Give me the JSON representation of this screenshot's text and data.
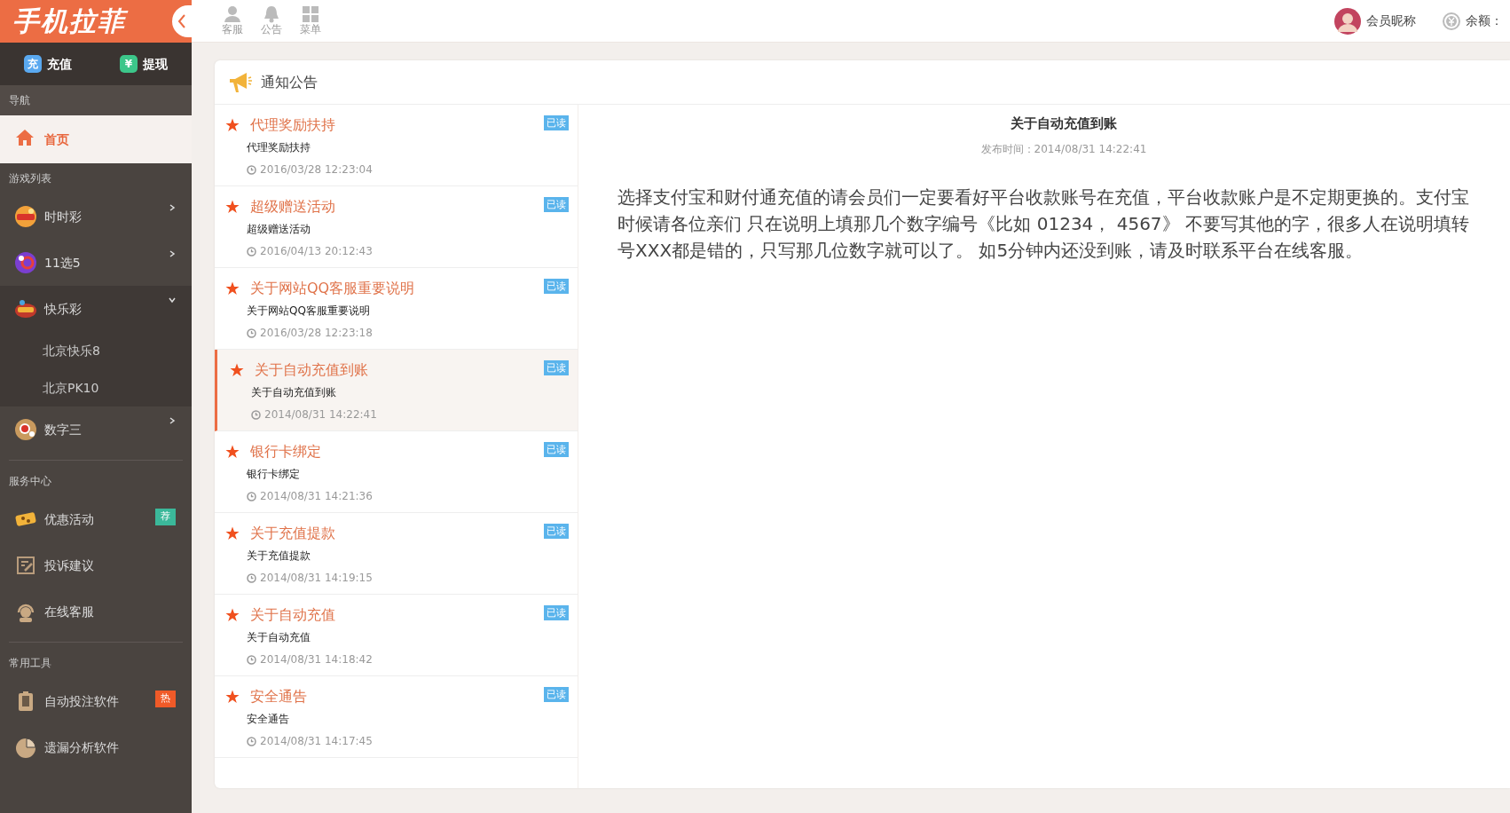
{
  "logo": {
    "text": "手机拉菲"
  },
  "quick_actions": [
    {
      "icon": "充",
      "label": "充值",
      "color": "#5aa9f0"
    },
    {
      "icon": "¥",
      "label": "提现",
      "color": "#3cc68a"
    }
  ],
  "toolbar": [
    {
      "label": "客服"
    },
    {
      "label": "公告"
    },
    {
      "label": "菜单"
    }
  ],
  "user": {
    "nickname": "会员昵称",
    "balance_label": "余额："
  },
  "sidebar": {
    "sections": [
      {
        "title": "导航",
        "items": [
          {
            "label": "首页",
            "selected": true
          }
        ]
      },
      {
        "title": "游戏列表",
        "items": [
          {
            "label": "时时彩",
            "selected": false,
            "expanded": false
          },
          {
            "label": "11选5",
            "selected": false,
            "expanded": false
          },
          {
            "label": "快乐彩",
            "selected": false,
            "expanded": true,
            "children": [
              {
                "label": "北京快乐8"
              },
              {
                "label": "北京PK10"
              }
            ]
          },
          {
            "label": "数字三",
            "selected": false,
            "expanded": false
          }
        ]
      },
      {
        "title": "服务中心",
        "items": [
          {
            "label": "优惠活动",
            "selected": false,
            "badge": {
              "text": "荐",
              "color": "#3bb89a"
            }
          },
          {
            "label": "投诉建议",
            "selected": false
          },
          {
            "label": "在线客服",
            "selected": false
          }
        ]
      },
      {
        "title": "常用工具",
        "items": [
          {
            "label": "自动投注软件",
            "selected": false,
            "badge": {
              "text": "热",
              "color": "#f05a28"
            }
          },
          {
            "label": "遗漏分析软件",
            "selected": false
          }
        ]
      }
    ]
  },
  "panel": {
    "title": "通知公告"
  },
  "notices": [
    {
      "title": "代理奖励扶持",
      "summary": "代理奖励扶持",
      "time": "2016/03/28 12:23:04",
      "status": "已读",
      "selected": false
    },
    {
      "title": "超级赠送活动",
      "summary": "超级赠送活动",
      "time": "2016/04/13 20:12:43",
      "status": "已读",
      "selected": false
    },
    {
      "title": "关于网站QQ客服重要说明",
      "summary": "关于网站QQ客服重要说明",
      "time": "2016/03/28 12:23:18",
      "status": "已读",
      "selected": false
    },
    {
      "title": "关于自动充值到账",
      "summary": "关于自动充值到账",
      "time": "2014/08/31 14:22:41",
      "status": "已读",
      "selected": true
    },
    {
      "title": "银行卡绑定",
      "summary": "银行卡绑定",
      "time": "2014/08/31 14:21:36",
      "status": "已读",
      "selected": false
    },
    {
      "title": "关于充值提款",
      "summary": "关于充值提款",
      "time": "2014/08/31 14:19:15",
      "status": "已读",
      "selected": false
    },
    {
      "title": "关于自动充值",
      "summary": "关于自动充值",
      "time": "2014/08/31 14:18:42",
      "status": "已读",
      "selected": false
    },
    {
      "title": "安全通告",
      "summary": "安全通告",
      "time": "2014/08/31 14:17:45",
      "status": "已读",
      "selected": false
    }
  ],
  "detail": {
    "title": "关于自动充值到账",
    "meta": "发布时间：2014/08/31 14:22:41",
    "body_lines": [
      "选择支付宝和财付通充值的请会员们一定要看好平台收款账号在充值，平台收款账户是不定期更换的。支付宝",
      "时候请各位亲们 只在说明上填那几个数字编号《比如 01234， 4567》 不要写其他的字，很多人在说明填转",
      "号XXX都是错的，只写那几位数字就可以了。 如5分钟内还没到账，请及时联系平台在线客服。"
    ]
  }
}
